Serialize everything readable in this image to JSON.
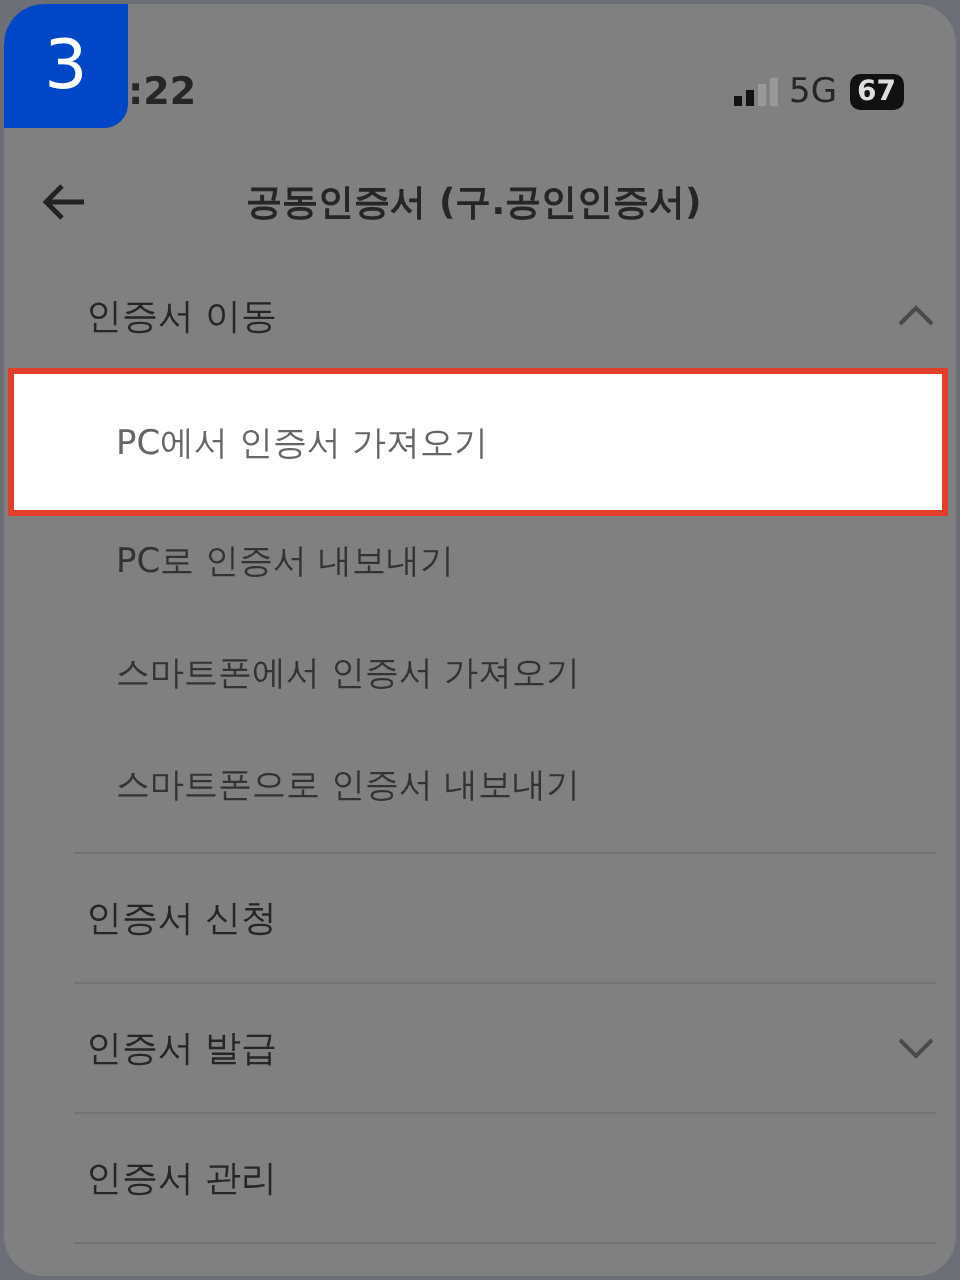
{
  "step_badge": "3",
  "status_bar": {
    "time": ":22",
    "network": "5G",
    "battery": "67"
  },
  "header": {
    "title": "공동인증서 (구.공인인증서)"
  },
  "menu": [
    {
      "label": "인증서 이동",
      "kind": "accordion",
      "expanded": true,
      "children": [
        {
          "label": "PC에서 인증서 가져오기",
          "selected": true
        },
        {
          "label": "PC로 인증서 내보내기",
          "selected": false
        },
        {
          "label": "스마트폰에서 인증서 가져오기",
          "selected": false
        },
        {
          "label": "스마트폰으로 인증서 내보내기",
          "selected": false
        }
      ]
    },
    {
      "label": "인증서 신청",
      "kind": "link"
    },
    {
      "label": "인증서 발급",
      "kind": "accordion",
      "expanded": false
    },
    {
      "label": "인증서 관리",
      "kind": "link"
    }
  ]
}
